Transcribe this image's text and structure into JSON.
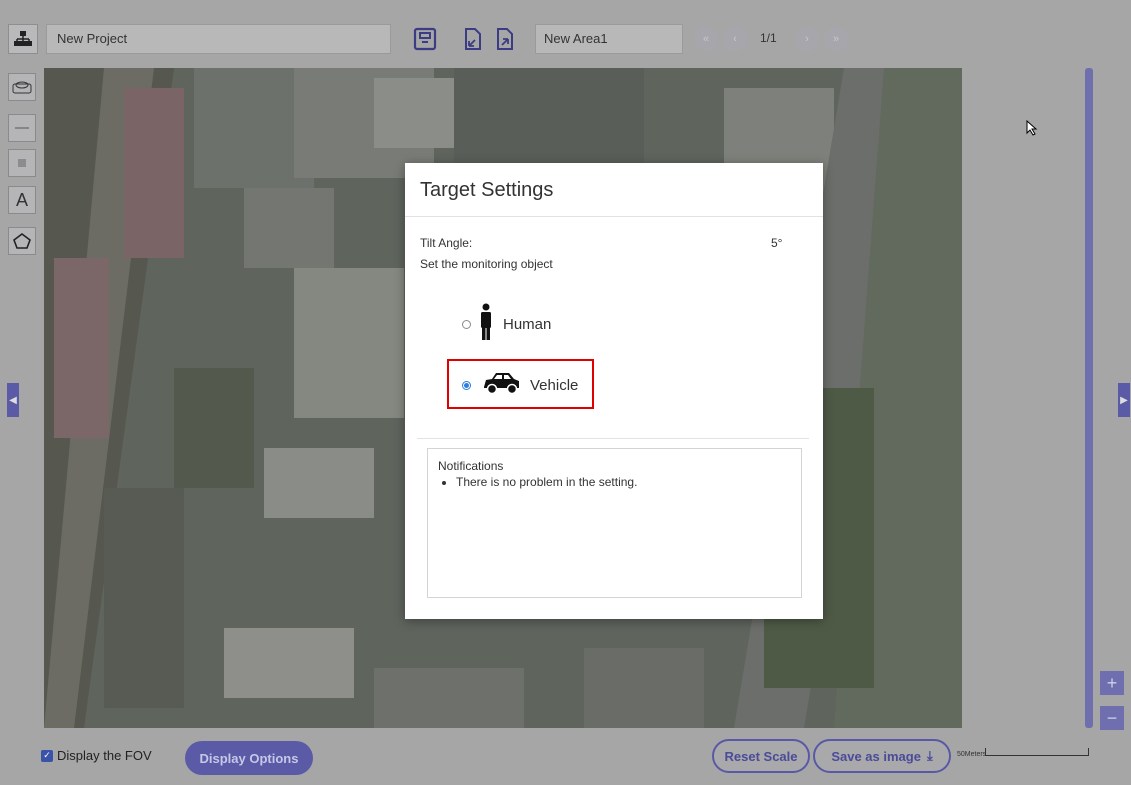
{
  "toolbar": {
    "project_name": "New Project",
    "area_name": "New Area1",
    "page_indicator": "1/1"
  },
  "icons": {
    "network": "network-tree-icon",
    "save": "save-floppy-icon",
    "import": "import-arrow-icon",
    "export": "export-arrow-icon",
    "first": "first-page-icon",
    "prev": "prev-page-icon",
    "next": "next-page-icon",
    "last": "last-page-icon",
    "camera": "camera-tool-icon",
    "line": "line-tool-icon",
    "rect": "rect-tool-icon",
    "text_tool": "A",
    "polygon": "polygon-tool-icon"
  },
  "modal": {
    "title": "Target Settings",
    "tilt_label": "Tilt Angle:",
    "tilt_value": "5°",
    "monitor_label": "Set the monitoring object",
    "options": [
      {
        "label": "Human",
        "selected": false
      },
      {
        "label": "Vehicle",
        "selected": true
      }
    ],
    "notifications_title": "Notifications",
    "notifications": [
      "There is no problem in the setting."
    ]
  },
  "bottom": {
    "fov_label": "Display the FOV",
    "fov_checked": true,
    "display_options": "Display Options",
    "reset_scale": "Reset Scale",
    "save_image": "Save as image",
    "scale_label": "50Meters"
  },
  "colors": {
    "accent": "#5a5aa7",
    "highlight": "#e00000",
    "radio_selected": "#2b7de0"
  }
}
